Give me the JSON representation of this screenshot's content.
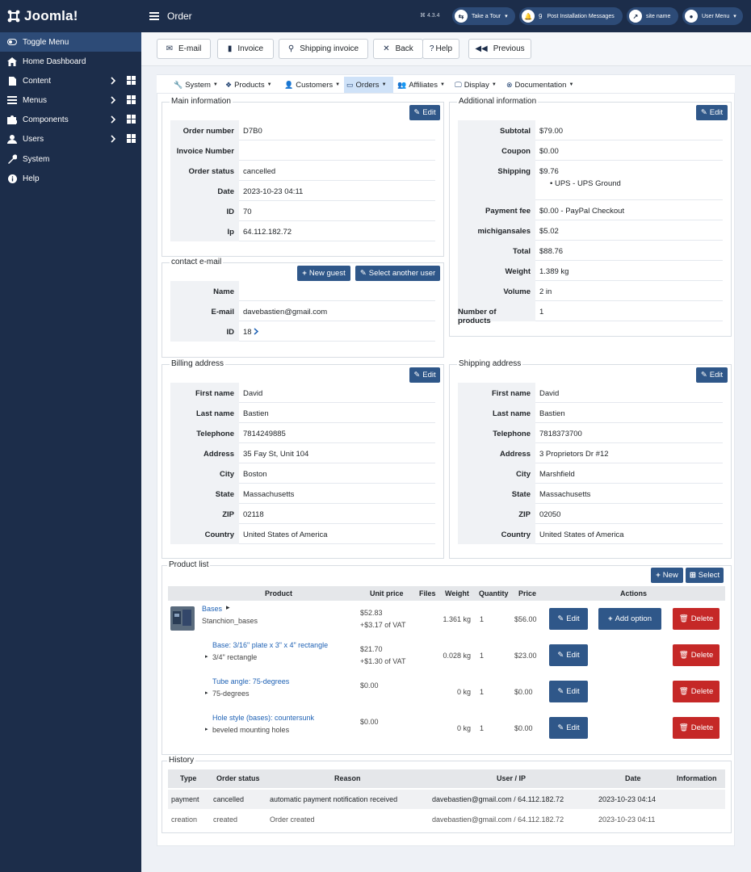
{
  "app": {
    "logo": "Joomla!"
  },
  "sidebar": {
    "items": [
      {
        "label": "Toggle Menu"
      },
      {
        "label": "Home Dashboard"
      },
      {
        "label": "Content"
      },
      {
        "label": "Menus"
      },
      {
        "label": "Components"
      },
      {
        "label": "Users"
      },
      {
        "label": "System"
      },
      {
        "label": "Help"
      }
    ]
  },
  "topbar": {
    "title": "Order",
    "version": "4.3.4",
    "take_tour": "Take a Tour",
    "post_install_count": "9",
    "post_install": "Post Installation Messages",
    "site_name": "site name",
    "user_menu": "User Menu"
  },
  "toolbar": {
    "email": "E-mail",
    "invoice": "Invoice",
    "shipping_invoice": "Shipping invoice",
    "back": "Back",
    "help": "Help",
    "previous": "Previous"
  },
  "hmenu": {
    "items": [
      "System",
      "Products",
      "Customers",
      "Orders",
      "Affiliates",
      "Display",
      "Documentation"
    ]
  },
  "main_info": {
    "legend": "Main information",
    "edit": "Edit",
    "rows": [
      {
        "label": "Order number",
        "value": "D7B0"
      },
      {
        "label": "Invoice Number",
        "value": ""
      },
      {
        "label": "Order status",
        "value": "cancelled"
      },
      {
        "label": "Date",
        "value": "2023-10-23 04:11"
      },
      {
        "label": "ID",
        "value": "70"
      },
      {
        "label": "Ip",
        "value": "64.112.182.72"
      }
    ]
  },
  "contact": {
    "legend": "contact e-mail",
    "new_guest": "New guest",
    "select_user": "Select another user",
    "rows": [
      {
        "label": "Name",
        "value": ""
      },
      {
        "label": "E-mail",
        "value": "davebastien@gmail.com"
      },
      {
        "label": "ID",
        "value": "18"
      }
    ]
  },
  "additional": {
    "legend": "Additional information",
    "edit": "Edit",
    "rows": [
      {
        "label": "Subtotal",
        "value": "$79.00"
      },
      {
        "label": "Coupon",
        "value": "$0.00"
      },
      {
        "label": "Shipping",
        "value": "$9.76",
        "sub": "UPS - UPS Ground"
      },
      {
        "label": "Payment fee",
        "value": "$0.00 - PayPal Checkout"
      },
      {
        "label": "michigansales",
        "value": "$5.02"
      },
      {
        "label": "Total",
        "value": "$88.76"
      },
      {
        "label": "Weight",
        "value": "1.389 kg"
      },
      {
        "label": "Volume",
        "value": "2 in"
      },
      {
        "label": "Number of products",
        "value": "1"
      }
    ]
  },
  "billing": {
    "legend": "Billing address",
    "edit": "Edit",
    "rows": [
      {
        "label": "First name",
        "value": "David"
      },
      {
        "label": "Last name",
        "value": "Bastien"
      },
      {
        "label": "Telephone",
        "value": "7814249885"
      },
      {
        "label": "Address",
        "value": "35 Fay St, Unit 104"
      },
      {
        "label": "City",
        "value": "Boston"
      },
      {
        "label": "State",
        "value": "Massachusetts"
      },
      {
        "label": "ZIP",
        "value": "02118"
      },
      {
        "label": "Country",
        "value": "United States of America"
      }
    ]
  },
  "shipping": {
    "legend": "Shipping address",
    "edit": "Edit",
    "rows": [
      {
        "label": "First name",
        "value": "David"
      },
      {
        "label": "Last name",
        "value": "Bastien"
      },
      {
        "label": "Telephone",
        "value": "7818373700"
      },
      {
        "label": "Address",
        "value": "3 Proprietors Dr #12"
      },
      {
        "label": "City",
        "value": "Marshfield"
      },
      {
        "label": "State",
        "value": "Massachusetts"
      },
      {
        "label": "ZIP",
        "value": "02050"
      },
      {
        "label": "Country",
        "value": "United States of America"
      }
    ]
  },
  "products": {
    "legend": "Product list",
    "new": "New",
    "select": "Select",
    "headers": [
      "Product",
      "Unit price",
      "Files",
      "Weight",
      "Quantity",
      "Price",
      "Actions"
    ],
    "edit": "Edit",
    "add_option": "Add option",
    "delete": "Delete",
    "rows": [
      {
        "name": "Bases",
        "sub": "Stanchion_bases",
        "price1": "$52.83",
        "price2": "+$3.17 of VAT",
        "weight": "1.361 kg",
        "qty": "1",
        "total": "$56.00"
      },
      {
        "name": "Base: 3/16\" plate x 3\" x 4\" rectangle",
        "sub": "3/4\" rectangle",
        "price1": "$21.70",
        "price2": "+$1.30 of VAT",
        "weight": "0.028 kg",
        "qty": "1",
        "total": "$23.00"
      },
      {
        "name": "Tube angle: 75-degrees",
        "sub": "75-degrees",
        "price1": "$0.00",
        "price2": "",
        "weight": "0 kg",
        "qty": "1",
        "total": "$0.00"
      },
      {
        "name": "Hole style (bases): countersunk",
        "sub": "beveled mounting holes",
        "price1": "$0.00",
        "price2": "",
        "weight": "0 kg",
        "qty": "1",
        "total": "$0.00"
      }
    ]
  },
  "history": {
    "legend": "History",
    "headers": [
      "Type",
      "Order status",
      "Reason",
      "User / IP",
      "Date",
      "Information"
    ],
    "rows": [
      {
        "type": "payment",
        "status": "cancelled",
        "reason": "automatic payment notification received",
        "user": "davebastien@gmail.com / 64.112.182.72",
        "date": "2023-10-23 04:14",
        "info": ""
      },
      {
        "type": "creation",
        "status": "created",
        "reason": "Order created",
        "user": "davebastien@gmail.com / 64.112.182.72",
        "date": "2023-10-23 04:11",
        "info": ""
      }
    ]
  },
  "colors": {
    "sidebar": "#1c2d4a",
    "primary": "#2f5789",
    "danger": "#c52827",
    "link": "#1f62b5"
  }
}
